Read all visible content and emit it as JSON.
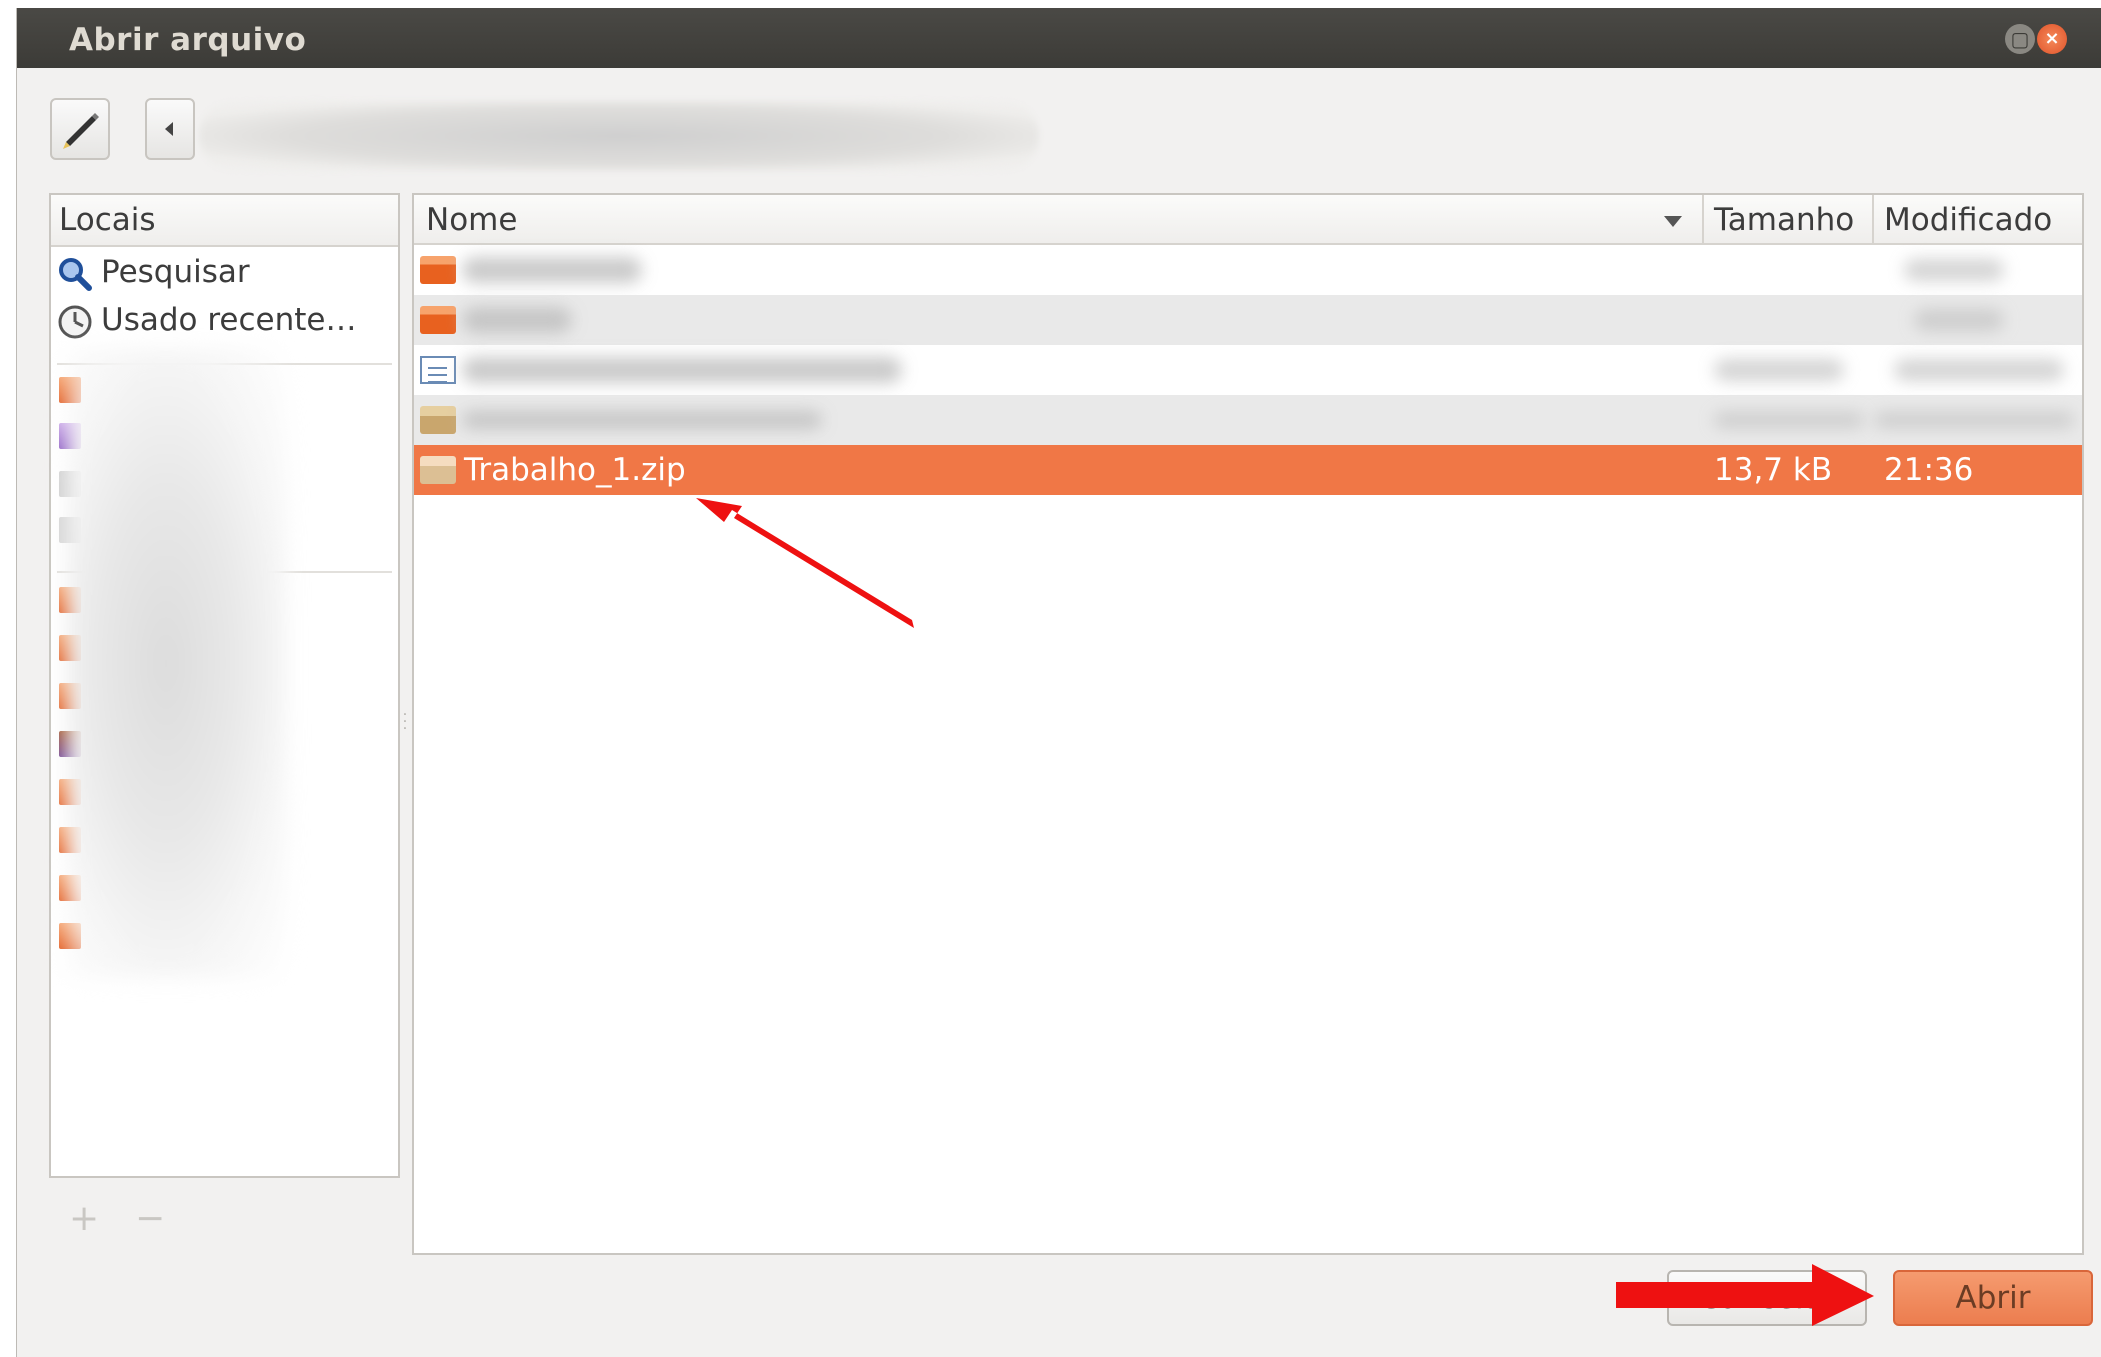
{
  "window": {
    "title": "Abrir arquivo"
  },
  "sidebar": {
    "header": "Locais",
    "items": [
      {
        "label": "Pesquisar",
        "icon": "search-icon"
      },
      {
        "label": "Usado recente…",
        "icon": "recent-icon"
      }
    ],
    "add_label": "+",
    "remove_label": "−"
  },
  "filelist": {
    "columns": {
      "name": "Nome",
      "size": "Tamanho",
      "modified": "Modificado"
    },
    "selected_file": {
      "name": "Trabalho_1.zip",
      "size": "13,7 kB",
      "modified": "21:36"
    }
  },
  "buttons": {
    "cancel": "Cancelar",
    "open": "Abrir"
  },
  "colors": {
    "selection": "#f07746",
    "titlebar": "#3c3b37",
    "annotation_arrow": "#ee1111"
  }
}
